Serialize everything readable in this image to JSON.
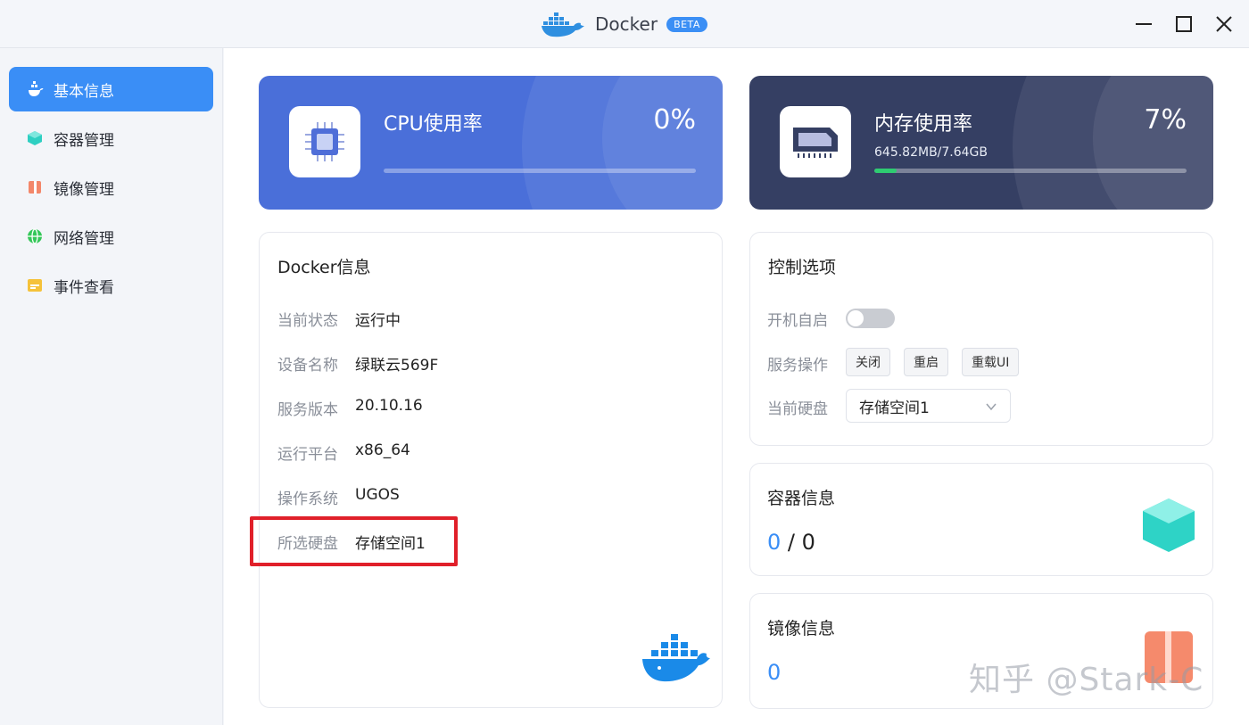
{
  "window": {
    "title": "Docker",
    "badge": "BETA"
  },
  "sidebar": {
    "items": [
      {
        "label": "基本信息",
        "icon": "dashboard-icon",
        "active": true
      },
      {
        "label": "容器管理",
        "icon": "container-icon",
        "active": false
      },
      {
        "label": "镜像管理",
        "icon": "image-icon",
        "active": false
      },
      {
        "label": "网络管理",
        "icon": "network-icon",
        "active": false
      },
      {
        "label": "事件查看",
        "icon": "event-icon",
        "active": false
      }
    ]
  },
  "cpu": {
    "title": "CPU使用率",
    "value": "0%",
    "percent": 0,
    "icon": "cpu-icon"
  },
  "memory": {
    "title": "内存使用率",
    "value": "7%",
    "usage": "645.82MB/7.64GB",
    "percent": 7,
    "icon": "memory-icon"
  },
  "docker_info": {
    "title": "Docker信息",
    "rows": [
      {
        "label": "当前状态",
        "value": "运行中"
      },
      {
        "label": "设备名称",
        "value": "绿联云569F"
      },
      {
        "label": "服务版本",
        "value": "20.10.16"
      },
      {
        "label": "运行平台",
        "value": "x86_64"
      },
      {
        "label": "操作系统",
        "value": "UGOS"
      },
      {
        "label": "所选硬盘",
        "value": "存储空间1"
      }
    ]
  },
  "control": {
    "title": "控制选项",
    "autostart_label": "开机自启",
    "autostart_on": false,
    "service_label": "服务操作",
    "buttons": {
      "stop": "关闭",
      "restart": "重启",
      "reload_ui": "重载UI"
    },
    "disk_label": "当前硬盘",
    "disk_value": "存储空间1"
  },
  "container_info": {
    "title": "容器信息",
    "running": "0",
    "separator": " / ",
    "total": "0"
  },
  "image_info": {
    "title": "镜像信息",
    "count": "0"
  },
  "watermark": "知乎 @Stark-C",
  "colors": {
    "accent": "#3a8ef6",
    "cpu_card": "#4a6fd9",
    "mem_card": "#353f63",
    "mem_bar": "#2ecc71",
    "highlight": "#e0202a"
  }
}
